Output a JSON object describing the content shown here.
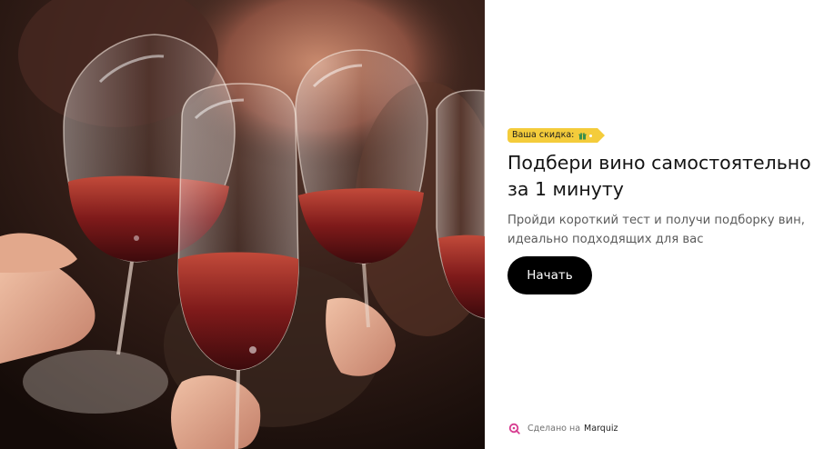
{
  "hero": {
    "image_icon": "wine-glasses-photo"
  },
  "quiz": {
    "discount_label": "Ваша скидка:",
    "discount_icon": "gift-icon",
    "title": "Подбери вино самостоятельно за 1 минуту",
    "subtitle": "Пройди короткий тест и получи подборку вин, идеально подходящих для вас",
    "start_label": "Начать"
  },
  "footer": {
    "made_with_text": "Сделано на",
    "brand": "Marquiz",
    "brand_icon": "marquiz-logo-icon"
  },
  "colors": {
    "badge": "#f4cc3b",
    "button": "#000000",
    "brand": "#d63b8f",
    "text": "#141414"
  }
}
